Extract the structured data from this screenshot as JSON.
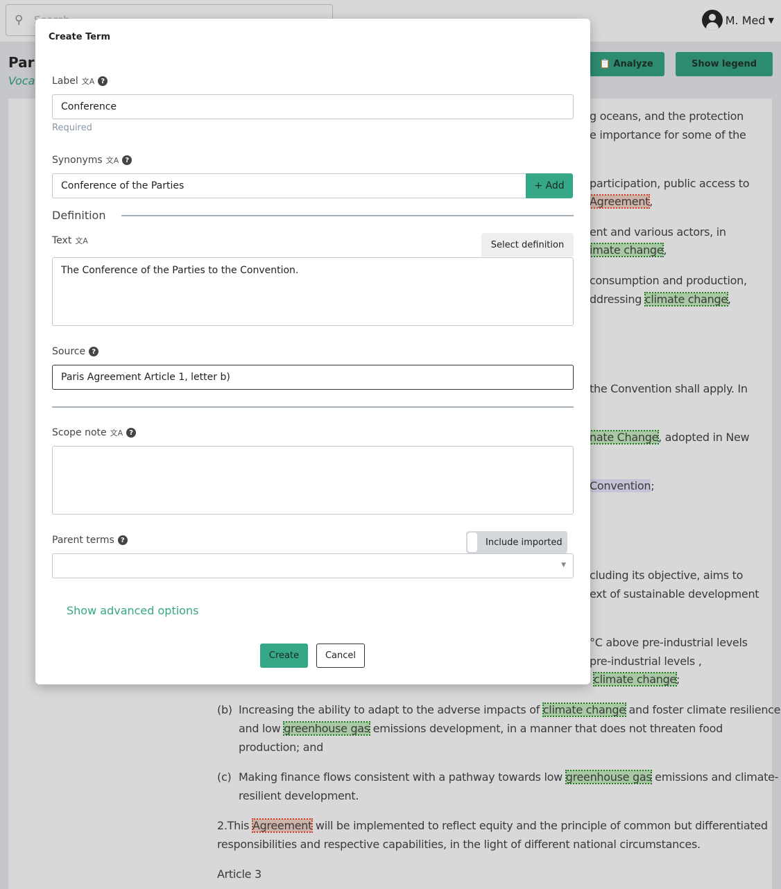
{
  "topbar": {
    "search_placeholder": "Search",
    "user_name": "M. Med"
  },
  "page": {
    "title": "Pari",
    "subtitle": "Voca",
    "analyze_label": "Analyze",
    "show_legend_label": "Show legend"
  },
  "document": {
    "fragments": [
      {
        "pre": "g oceans, and the protection",
        "hl": "",
        "post": ""
      },
      {
        "pre": "e importance for some of the",
        "hl": "",
        "post": ""
      },
      {
        "pre": "participation, public access to",
        "hl": "",
        "post": ""
      },
      {
        "pre": "",
        "hl": "Agreement",
        "post": ","
      },
      {
        "pre": "ent and various actors, in",
        "hl": "",
        "post": ""
      },
      {
        "pre": "",
        "hl": "imate change",
        "post": ","
      },
      {
        "pre": "consumption and production,",
        "hl": "",
        "post": ""
      },
      {
        "pre": "ddressing ",
        "hl": "climate change",
        "post": ","
      },
      {
        "pre": " the Convention shall apply. In",
        "hl": "",
        "post": ""
      },
      {
        "pre": "",
        "hl": "nate Change",
        "post": ", adopted in New"
      },
      {
        "pre": "",
        "hl": "Convention",
        "post": ";"
      },
      {
        "pre": "cluding its objective, aims to",
        "hl": "",
        "post": ""
      },
      {
        "pre": "ext of sustainable development",
        "hl": "",
        "post": ""
      },
      {
        "pre": " °C above pre-industrial levels",
        "hl": "",
        "post": ""
      },
      {
        "pre": " pre-industrial levels ,",
        "hl": "",
        "post": ""
      },
      {
        "pre": "",
        "hl": "climate change",
        "post": ";"
      }
    ],
    "item_b": {
      "marker": "(b)",
      "l1_pre": "Increasing the ability to adapt to the adverse impacts of ",
      "l1_hl": "climate change",
      "l1_post": " and foster climate resilience",
      "l2_pre": "and low ",
      "l2_hl": "greenhouse gas",
      "l2_post": " emissions development, in a manner that does not threaten food",
      "l3": "production; and"
    },
    "item_c": {
      "marker": "(c)",
      "l1_pre": "Making finance flows consistent with a pathway towards low ",
      "l1_hl": "greenhouse gas",
      "l1_post": " emissions and climate-",
      "l2": "resilient development."
    },
    "para2": {
      "pre": "2.This ",
      "hl": "Agreement",
      "post": " will be implemented to reflect equity and the principle of common but differentiated",
      "l2": "responsibilities and respective capabilities, in the light of different national circumstances."
    },
    "article": "Article 3"
  },
  "modal": {
    "title": "Create Term",
    "label": {
      "title": "Label",
      "value": "Conference",
      "hint": "Required"
    },
    "synonyms": {
      "title": "Synonyms",
      "value": "Conference of the Parties",
      "add_label": "+ Add"
    },
    "definition": {
      "heading": "Definition",
      "text_label": "Text",
      "select_label": "Select definition",
      "text_value": "The Conference of the Parties to the Convention."
    },
    "source": {
      "title": "Source",
      "value": "Paris Agreement Article 1, letter b)"
    },
    "scope_note": {
      "title": "Scope note",
      "value": ""
    },
    "parent_terms": {
      "title": "Parent terms",
      "toggle_label": "Include imported",
      "toggle_on": false,
      "value": ""
    },
    "advanced_label": "Show advanced options",
    "create_label": "Create",
    "cancel_label": "Cancel"
  },
  "colors": {
    "accent": "#36a887",
    "highlight_green": "#a9c9a4",
    "highlight_red": "#cdb3a8"
  }
}
